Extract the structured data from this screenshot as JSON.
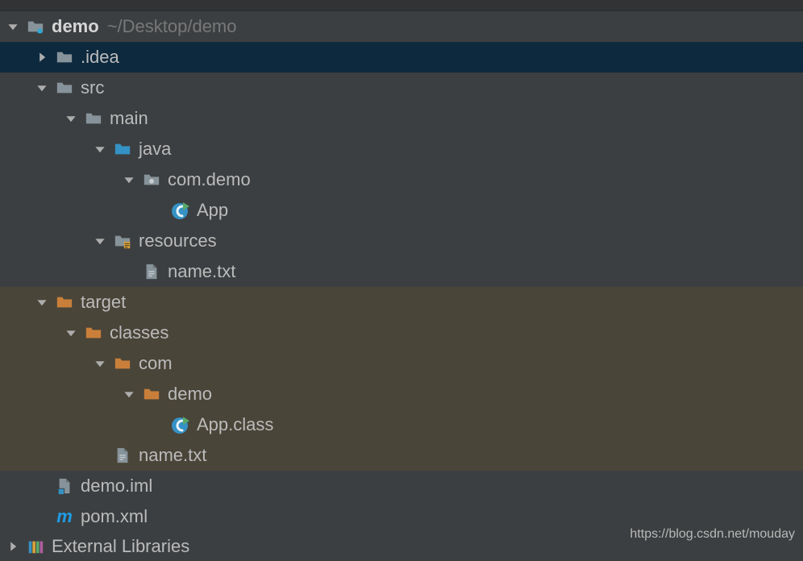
{
  "project": {
    "name": "demo",
    "path": "~/Desktop/demo"
  },
  "tree": {
    "idea": ".idea",
    "src": "src",
    "main": "main",
    "java": "java",
    "pkg": "com.demo",
    "app": "App",
    "resources": "resources",
    "nametxt1": "name.txt",
    "target": "target",
    "classes": "classes",
    "com": "com",
    "demo": "demo",
    "appclass": "App.class",
    "nametxt2": "name.txt",
    "iml": "demo.iml",
    "pom": "pom.xml",
    "extlib": "External Libraries"
  },
  "watermark": "https://blog.csdn.net/mouday"
}
